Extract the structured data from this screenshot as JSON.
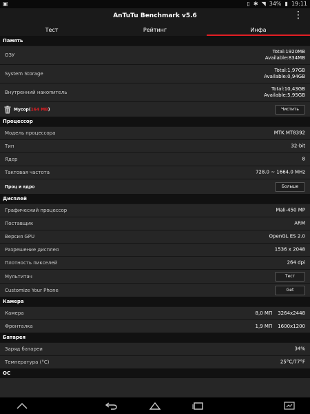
{
  "status": {
    "battery": "34%",
    "time": "19:11"
  },
  "app": {
    "title": "AnTuTu Benchmark v5.6"
  },
  "tabs": [
    "Тест",
    "Рейтинг",
    "Инфа"
  ],
  "memory": {
    "header": "Память",
    "ram": {
      "label": "ОЗУ",
      "total": "Total:1920MB",
      "available": "Available:834MB"
    },
    "system_storage": {
      "label": "System Storage",
      "total": "Total:1,97GB",
      "available": "Available:0,94GB"
    },
    "internal": {
      "label": "Внутренний накопитель",
      "total": "Total:10,43GB",
      "available": "Available:5,95GB"
    },
    "junk": {
      "label": "Мусор(",
      "amount": "164 MB",
      "close": ")",
      "button": "Чистить"
    }
  },
  "cpu": {
    "header": "Процессор",
    "model": {
      "label": "Модель процессора",
      "value": "MTK MT8392"
    },
    "type": {
      "label": "Тип",
      "value": "32-bit"
    },
    "cores": {
      "label": "Ядер",
      "value": "8"
    },
    "freq": {
      "label": "Тактовая частота",
      "value": "728.0 ~ 1664.0 MHz"
    },
    "more": {
      "label": "Проц и ядро",
      "button": "Больше"
    }
  },
  "display": {
    "header": "Дисплей",
    "gpu": {
      "label": "Графический процессор",
      "value": "Mali-450 MP"
    },
    "vendor": {
      "label": "Поставщик",
      "value": "ARM"
    },
    "gpu_version": {
      "label": "Версия GPU",
      "value": "OpenGL ES 2.0"
    },
    "resolution": {
      "label": "Разрешение дисплея",
      "value": "1536 x 2048"
    },
    "density": {
      "label": "Плотность пикселей",
      "value": "264 dpi"
    },
    "multitouch": {
      "label": "Мультитач",
      "button": "Тест"
    },
    "customize": {
      "label": "Customize Your Phone",
      "button": "Get"
    }
  },
  "camera": {
    "header": "Камера",
    "main": {
      "label": "Камера",
      "mp": "8,0 МП",
      "res": "3264x2448"
    },
    "front": {
      "label": "Фронталка",
      "mp": "1,9 МП",
      "res": "1600x1200"
    }
  },
  "battery": {
    "header": "Батарея",
    "charge": {
      "label": "Заряд батареи",
      "value": "34%"
    },
    "temp": {
      "label": "Температура (°C)",
      "value": "25°C/77°F"
    }
  },
  "os": {
    "header": "ОС"
  }
}
